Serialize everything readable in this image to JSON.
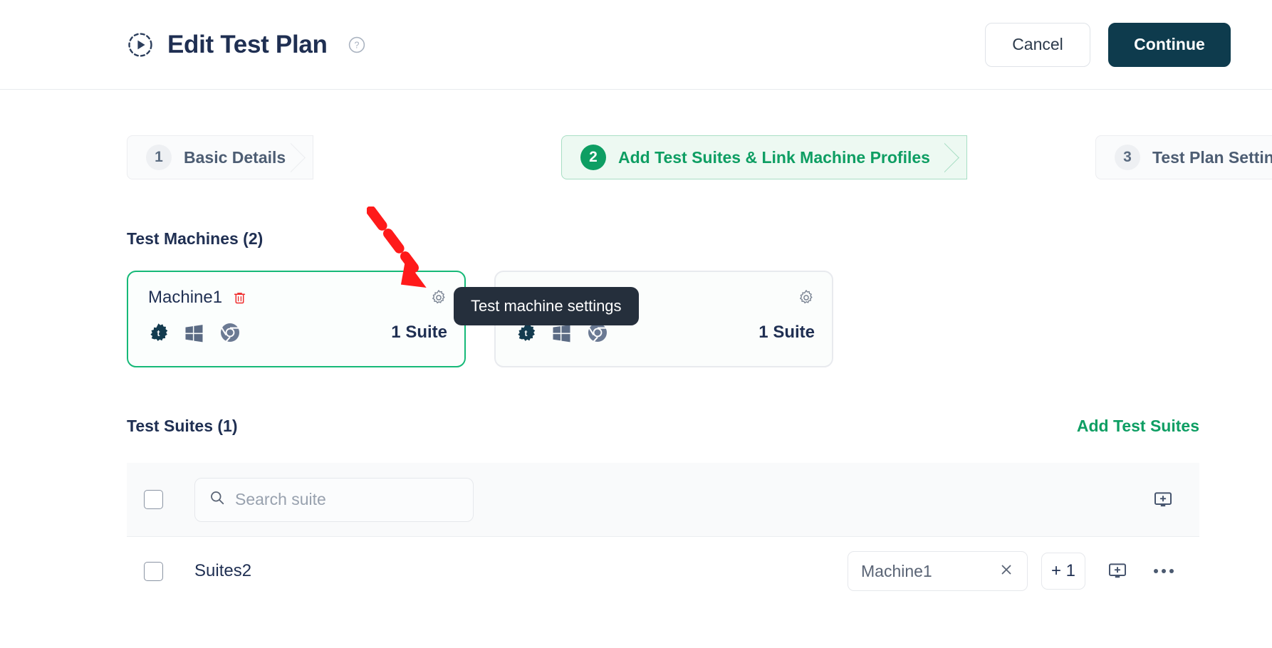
{
  "header": {
    "plan_icon": "play-circle-dashed-icon",
    "title": "Edit Test Plan",
    "help_icon": "help-circle-icon",
    "cancel_label": "Cancel",
    "continue_label": "Continue",
    "continue_color": "#0e3b4d"
  },
  "stepper": {
    "accent_color": "#0e9e63",
    "steps": [
      {
        "number": "1",
        "label": "Basic Details",
        "active": false
      },
      {
        "number": "2",
        "label": "Add Test Suites & Link Machine Profiles",
        "active": true
      },
      {
        "number": "3",
        "label": "Test Plan Settings",
        "active": false
      }
    ]
  },
  "machines": {
    "heading": "Test Machines (2)",
    "cards": [
      {
        "name": "Machine1",
        "selected": true,
        "delete_icon": "trash-icon",
        "settings_icon": "gear-icon",
        "os_icons": [
          "config-gear-icon",
          "windows-icon",
          "chrome-icon"
        ],
        "suite_count": "1 Suite"
      },
      {
        "name": "",
        "selected": false,
        "delete_icon": "trash-icon",
        "settings_icon": "gear-icon",
        "os_icons": [
          "config-gear-icon",
          "windows-icon",
          "chrome-icon"
        ],
        "suite_count": "1 Suite"
      }
    ]
  },
  "tooltip": {
    "text": "Test machine settings"
  },
  "annotation": {
    "arrow_color": "#ff1a1a",
    "type": "dashed-arrow"
  },
  "suites": {
    "heading": "Test Suites (1)",
    "add_link": "Add Test Suites",
    "search_placeholder": "Search suite",
    "search_value": "",
    "search_icon": "search-icon",
    "select_all_checkbox": false,
    "add_machine_icon": "monitor-plus-icon",
    "rows": [
      {
        "checked": false,
        "name": "Suites2",
        "machine_chip": "Machine1",
        "chip_remove_icon": "close-icon",
        "extra_count": "+ 1",
        "add_machine_icon": "monitor-plus-icon",
        "more_icon": "more-horizontal-icon"
      }
    ]
  }
}
